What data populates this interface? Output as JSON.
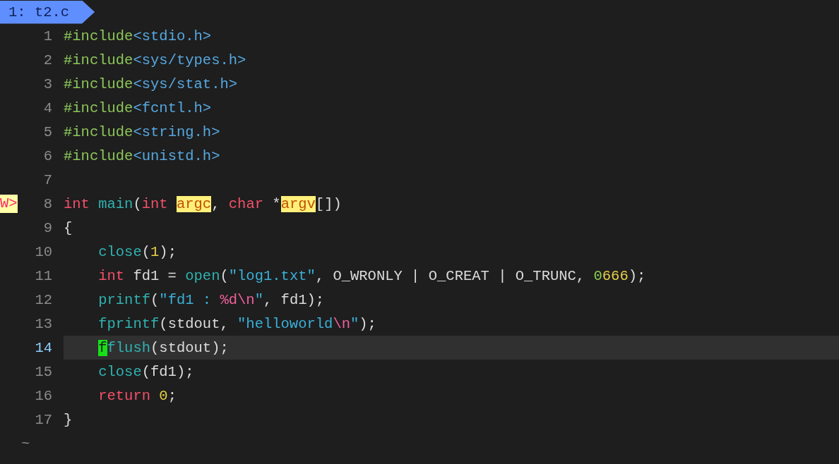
{
  "tabline": {
    "label": "1: t2.c"
  },
  "lines": [
    {
      "number": "1",
      "current": false,
      "tokens": [
        {
          "text": "#include",
          "kind": "preproc"
        },
        {
          "text": "<stdio.h>",
          "kind": "header"
        }
      ]
    },
    {
      "number": "2",
      "current": false,
      "tokens": [
        {
          "text": "#include",
          "kind": "preproc"
        },
        {
          "text": "<sys/types.h>",
          "kind": "header"
        }
      ]
    },
    {
      "number": "3",
      "current": false,
      "tokens": [
        {
          "text": "#include",
          "kind": "preproc"
        },
        {
          "text": "<sys/stat.h>",
          "kind": "header"
        }
      ]
    },
    {
      "number": "4",
      "current": false,
      "tokens": [
        {
          "text": "#include",
          "kind": "preproc"
        },
        {
          "text": "<fcntl.h>",
          "kind": "header"
        }
      ]
    },
    {
      "number": "5",
      "current": false,
      "tokens": [
        {
          "text": "#include",
          "kind": "preproc"
        },
        {
          "text": "<string.h>",
          "kind": "header"
        }
      ]
    },
    {
      "number": "6",
      "current": false,
      "tokens": [
        {
          "text": "#include",
          "kind": "preproc"
        },
        {
          "text": "<unistd.h>",
          "kind": "header"
        }
      ]
    },
    {
      "number": "7",
      "current": false
    },
    {
      "number": "8",
      "current": false,
      "sign": "W>",
      "tokens": [
        {
          "text": "int ",
          "kind": "keyword"
        },
        {
          "text": "main",
          "kind": "func"
        },
        {
          "text": "(",
          "kind": "plain"
        },
        {
          "text": "int ",
          "kind": "keyword"
        },
        {
          "text": "argc",
          "kind": "match"
        },
        {
          "text": ", ",
          "kind": "plain"
        },
        {
          "text": "char",
          "kind": "keyword"
        },
        {
          "text": " *",
          "kind": "plain"
        },
        {
          "text": "argv",
          "kind": "match"
        },
        {
          "text": "[])",
          "kind": "plain"
        }
      ]
    },
    {
      "number": "9",
      "current": false,
      "tokens": [
        {
          "text": "{",
          "kind": "plain"
        }
      ]
    },
    {
      "number": "10",
      "current": false,
      "indented": true,
      "tokens": [
        {
          "text": "close",
          "kind": "func"
        },
        {
          "text": "(",
          "kind": "plain"
        },
        {
          "text": "1",
          "kind": "number"
        },
        {
          "text": ");",
          "kind": "plain"
        }
      ]
    },
    {
      "number": "11",
      "current": false,
      "indented": true,
      "tokens": [
        {
          "text": "int",
          "kind": "keyword"
        },
        {
          "text": " fd1 = ",
          "kind": "plain"
        },
        {
          "text": "open",
          "kind": "func"
        },
        {
          "text": "(",
          "kind": "plain"
        },
        {
          "text": "\"log1.txt\"",
          "kind": "string"
        },
        {
          "text": ", O_WRONLY | O_CREAT | O_TRUNC, ",
          "kind": "plain"
        },
        {
          "text": "0",
          "kind": "octal"
        },
        {
          "text": "666",
          "kind": "number"
        },
        {
          "text": ");",
          "kind": "plain"
        }
      ]
    },
    {
      "number": "12",
      "current": false,
      "indented": true,
      "tokens": [
        {
          "text": "printf",
          "kind": "func"
        },
        {
          "text": "(",
          "kind": "plain"
        },
        {
          "text": "\"fd1 : ",
          "kind": "string"
        },
        {
          "text": "%d\\n",
          "kind": "escape"
        },
        {
          "text": "\"",
          "kind": "string"
        },
        {
          "text": ", fd1);",
          "kind": "plain"
        }
      ]
    },
    {
      "number": "13",
      "current": false,
      "indented": true,
      "tokens": [
        {
          "text": "fprintf",
          "kind": "func"
        },
        {
          "text": "(stdout, ",
          "kind": "plain"
        },
        {
          "text": "\"helloworld",
          "kind": "string"
        },
        {
          "text": "\\n",
          "kind": "escape"
        },
        {
          "text": "\"",
          "kind": "string"
        },
        {
          "text": ");",
          "kind": "plain"
        }
      ]
    },
    {
      "number": "14",
      "current": true,
      "indented": true,
      "tokens": [
        {
          "text": "f",
          "kind": "cursor"
        },
        {
          "text": "flush",
          "kind": "func"
        },
        {
          "text": "(stdout);",
          "kind": "plain"
        }
      ]
    },
    {
      "number": "15",
      "current": false,
      "indented": true,
      "tokens": [
        {
          "text": "close",
          "kind": "func"
        },
        {
          "text": "(fd1);",
          "kind": "plain"
        }
      ]
    },
    {
      "number": "16",
      "current": false,
      "indented": true,
      "tokens": [
        {
          "text": "return ",
          "kind": "keyword"
        },
        {
          "text": "0",
          "kind": "number"
        },
        {
          "text": ";",
          "kind": "plain"
        }
      ]
    },
    {
      "number": "17",
      "current": false,
      "tokens": [
        {
          "text": "}",
          "kind": "plain"
        }
      ]
    }
  ],
  "filler": [
    "~"
  ]
}
